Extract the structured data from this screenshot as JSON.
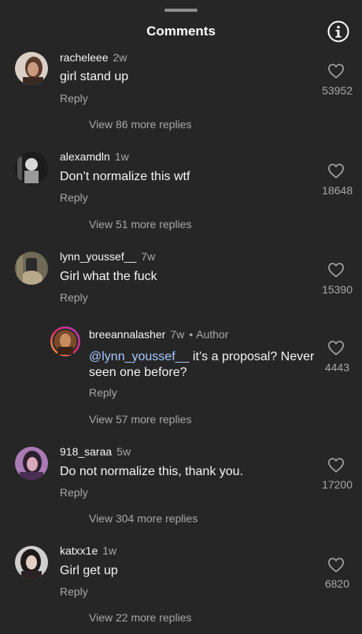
{
  "header": {
    "title": "Comments"
  },
  "comments": [
    {
      "username": "racheleee",
      "time": "2w",
      "text": "girl stand up",
      "reply_label": "Reply",
      "likes": "53952",
      "view_more": "View 86 more replies"
    },
    {
      "username": "alexamdln",
      "time": "1w",
      "text": "Don’t normalize this wtf",
      "reply_label": "Reply",
      "likes": "18648",
      "view_more": "View 51 more replies"
    },
    {
      "username": "lynn_youssef__",
      "time": "7w",
      "text": "Girl what the fuck",
      "reply_label": "Reply",
      "likes": "15390"
    },
    {
      "username": "918_saraa",
      "time": "5w",
      "text": "Do not normalize this, thank you.",
      "reply_label": "Reply",
      "likes": "17200",
      "view_more": "View 304 more replies"
    },
    {
      "username": "katxx1e",
      "time": "1w",
      "text": "Girl get up",
      "reply_label": "Reply",
      "likes": "6820",
      "view_more": "View 22 more replies"
    }
  ],
  "nested_reply": {
    "username": "breeannalasher",
    "time": "7w",
    "dot": "•",
    "author_label": "Author",
    "mention": "@lynn_youssef__",
    "text_line1": " it’s a proposal? Never",
    "text_line2": "seen one before?",
    "reply_label": "Reply",
    "likes": "4443",
    "view_more": "View 57 more replies"
  }
}
